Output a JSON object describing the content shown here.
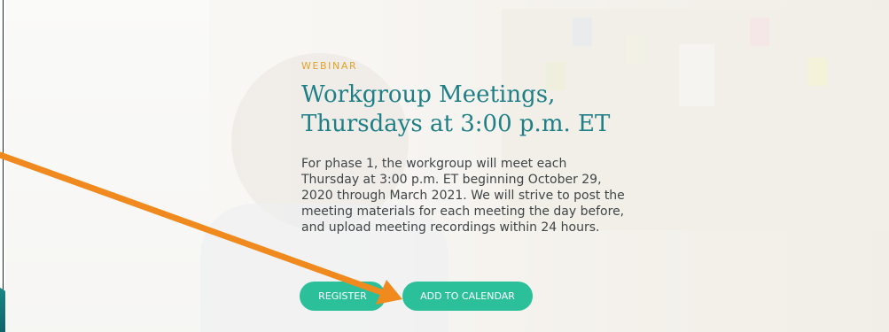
{
  "hero": {
    "eyebrow": "WEBINAR",
    "title_lines": [
      "Workgroup Meetings,",
      "Thursdays at 3:00 p.m. ET"
    ],
    "description_lines": [
      "For phase 1, the workgroup will meet each",
      "Thursday at 3:00 p.m. ET beginning October 29,",
      "2020 through March 2021. We will strive to post the",
      "meeting materials for each meeting the day before,",
      "and upload meeting recordings within 24 hours."
    ],
    "buttons": {
      "register": "REGISTER",
      "add_to_calendar": "ADD TO CALENDAR"
    }
  },
  "annotation": {
    "arrow_color": "#f08a1e"
  },
  "colors": {
    "accent_teal": "#1e7f86",
    "eyebrow_gold": "#e0a22a",
    "button_green": "#2bbf9a",
    "text_body": "#3f4547"
  }
}
